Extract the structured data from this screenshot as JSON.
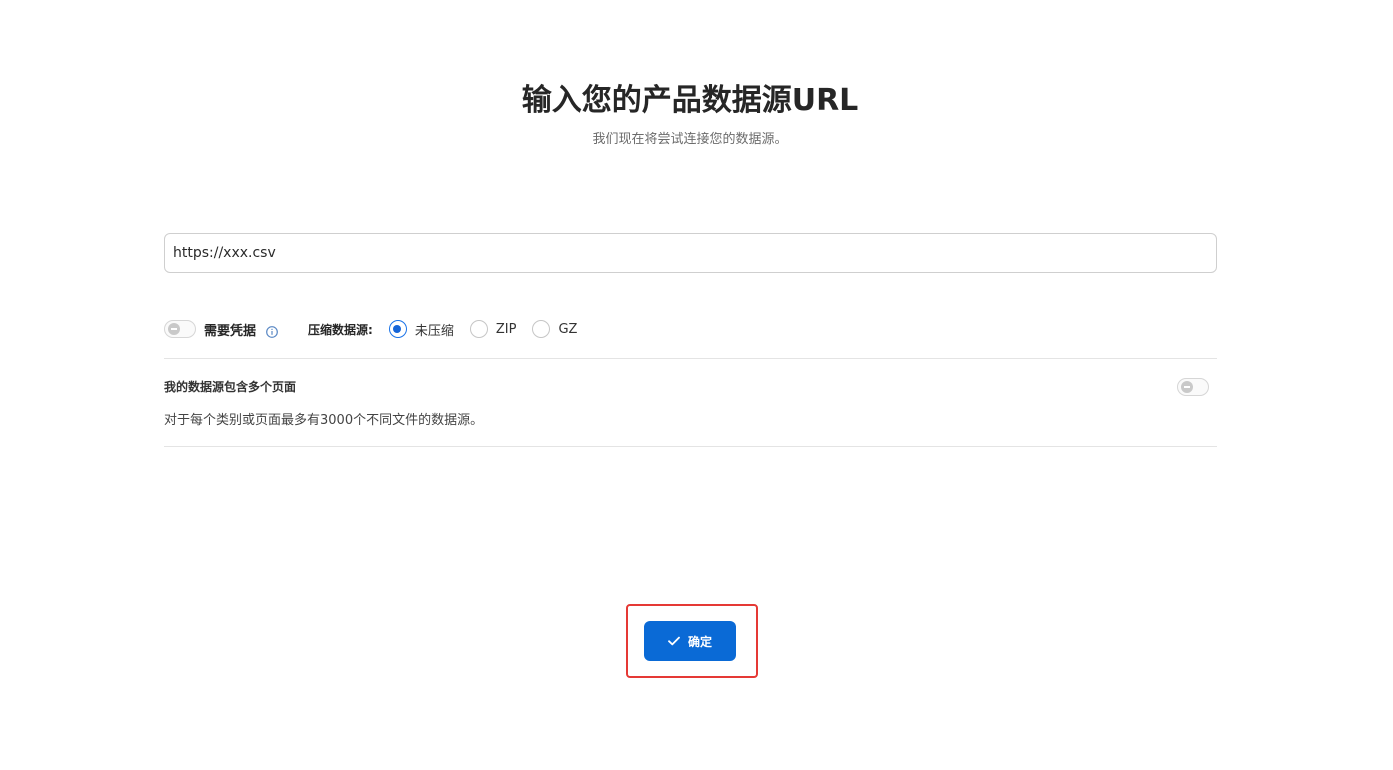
{
  "header": {
    "title": "输入您的产品数据源URL",
    "subtitle": "我们现在将尝试连接您的数据源。"
  },
  "url_field": {
    "value": "https://xxx.csv",
    "placeholder": ""
  },
  "credentials": {
    "label": "需要凭据",
    "enabled": false
  },
  "compression": {
    "label": "压缩数据源:",
    "options": [
      "未压缩",
      "ZIP",
      "GZ"
    ],
    "selected": "未压缩"
  },
  "multi_page": {
    "title": "我的数据源包含多个页面",
    "description": "对于每个类别或页面最多有3000个不同文件的数据源。",
    "enabled": false
  },
  "actions": {
    "confirm_label": "确定"
  },
  "colors": {
    "primary": "#0a6ad6",
    "highlight": "#e53935",
    "info_icon": "#5a88c4"
  },
  "icons": {
    "info": "info-icon",
    "confirm": "checkmark-icon"
  }
}
